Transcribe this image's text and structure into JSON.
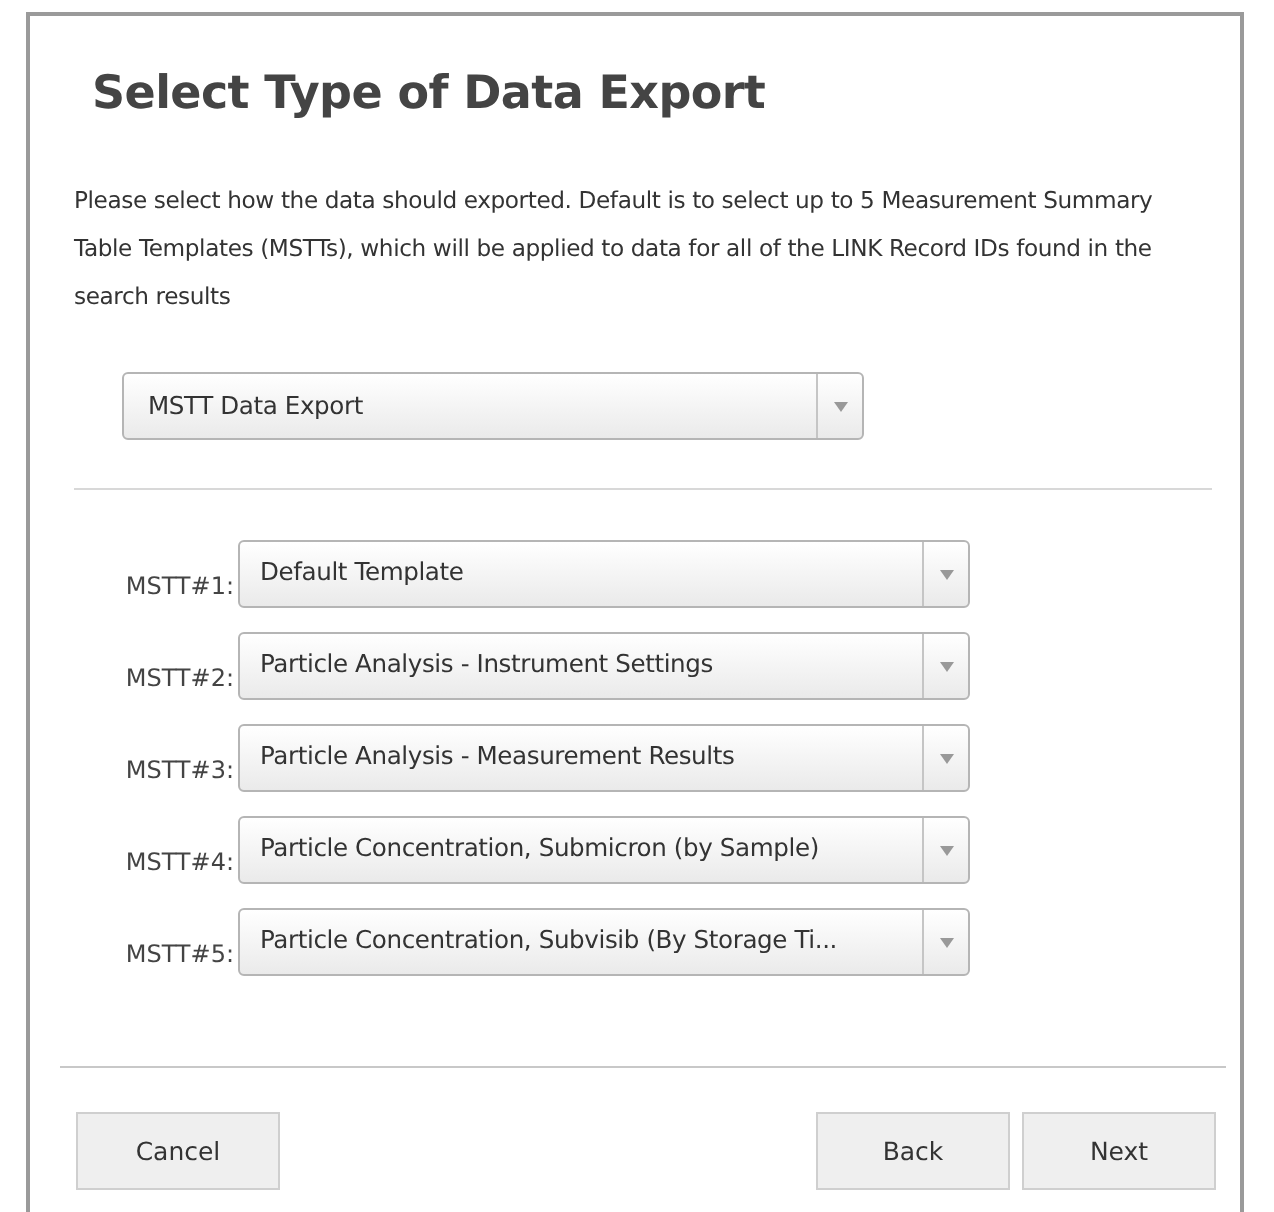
{
  "dialog": {
    "title": "Select Type of Data Export",
    "description": "Please select how the data should exported. Default is to select up to 5 Measurement Summary Table Templates (MSTTs), which will be applied to data for all of the LINK Record IDs found in the search results",
    "export_type": {
      "value": "MSTT Data Export"
    },
    "templates": [
      {
        "label": "MSTT#1:",
        "value": "Default Template"
      },
      {
        "label": "MSTT#2:",
        "value": "Particle Analysis - Instrument Settings"
      },
      {
        "label": "MSTT#3:",
        "value": "Particle Analysis - Measurement Results"
      },
      {
        "label": "MSTT#4:",
        "value": "Particle Concentration, Submicron (by Sample)"
      },
      {
        "label": "MSTT#5:",
        "value": "Particle Concentration, Subvisib (By Storage Ti..."
      }
    ],
    "buttons": {
      "left": [
        "Cancel"
      ],
      "right": [
        "Back",
        "Next"
      ]
    }
  }
}
